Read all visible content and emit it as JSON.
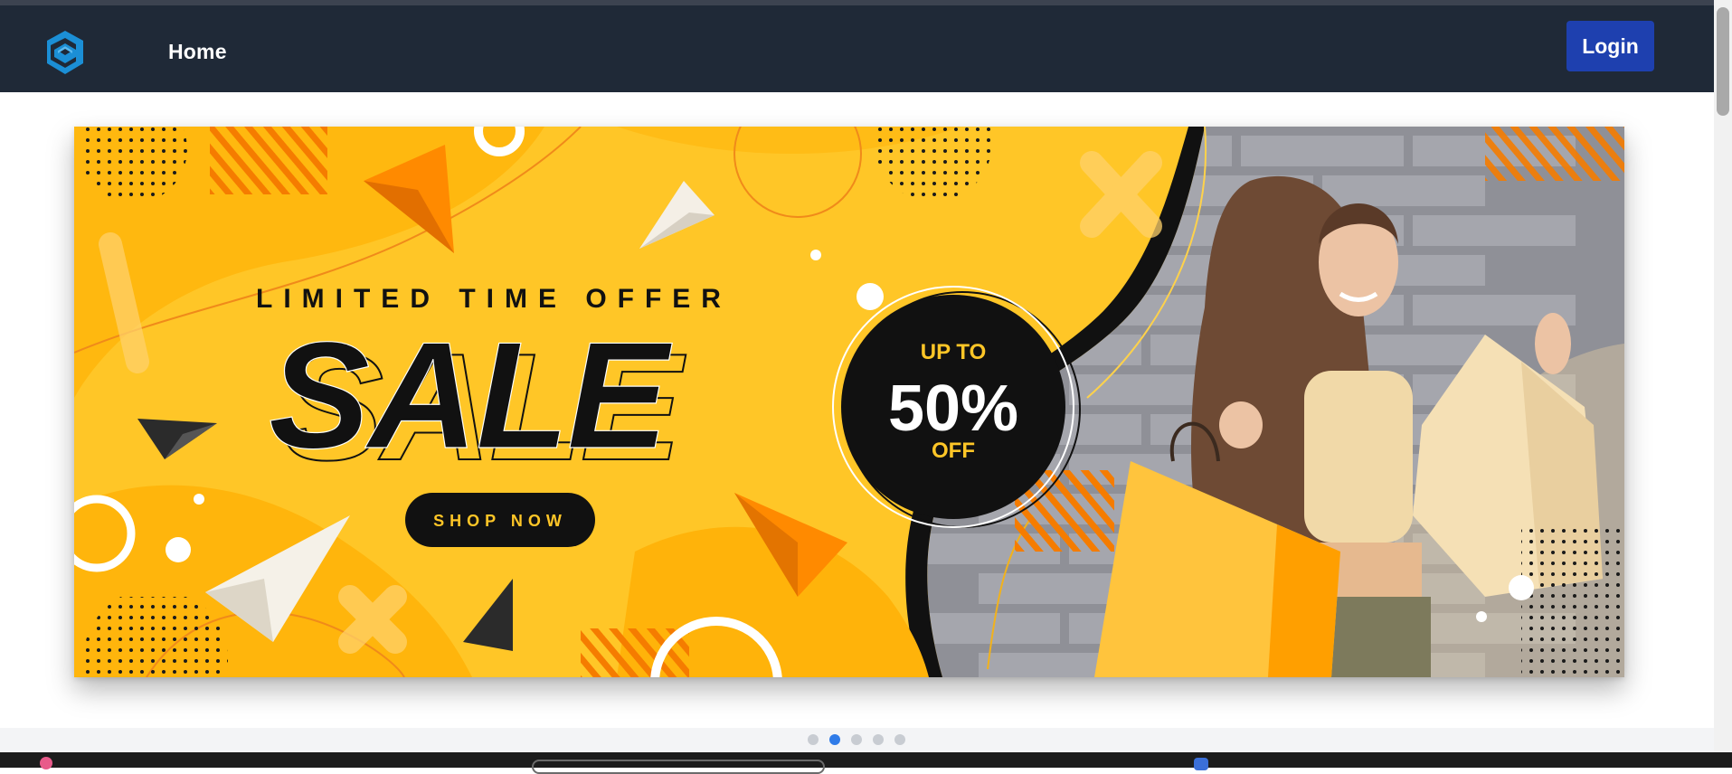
{
  "nav": {
    "logo_icon": "cube-e-logo-icon",
    "home_label": "Home",
    "login_label": "Login"
  },
  "banner": {
    "eyebrow": "LIMITED TIME OFFER",
    "headline": "SALE",
    "cta_label": "SHOP NOW",
    "badge_top": "UP TO",
    "badge_value": "50%",
    "badge_bottom": "OFF"
  },
  "carousel": {
    "slide_count": 5,
    "active_index": 1
  },
  "colors": {
    "navbar": "#1f2937",
    "login_button": "#1e40af",
    "banner_yellow": "#fdc21d",
    "accent_orange": "#ff8a00",
    "logo_blue": "#1b8fd6"
  }
}
